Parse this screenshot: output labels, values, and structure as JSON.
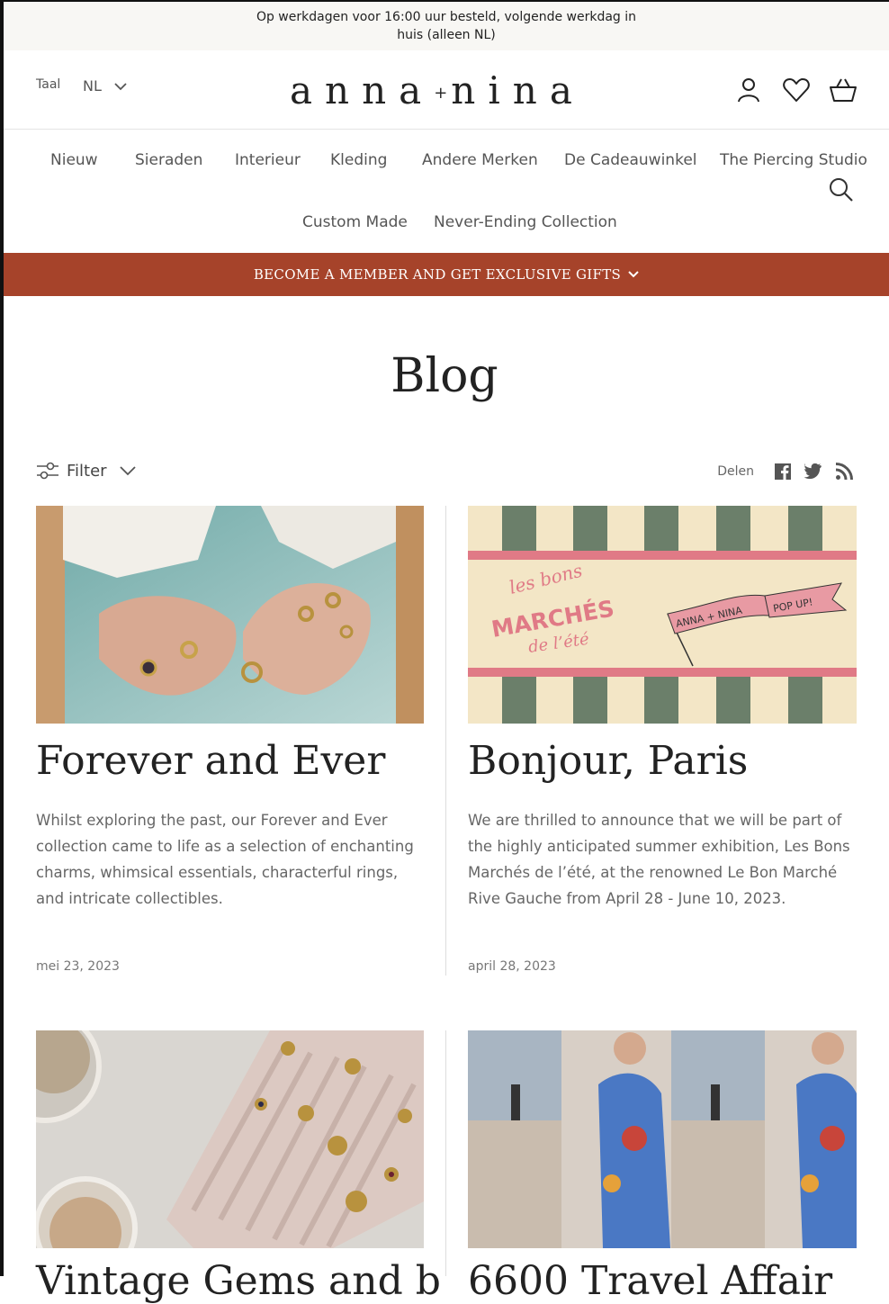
{
  "announcement": {
    "text": "Op werkdagen voor 16:00 uur besteld, volgende werkdag in huis (alleen NL)"
  },
  "header": {
    "language_label": "Taal",
    "language_value": "NL",
    "logo_left": "anna",
    "logo_plus": "+",
    "logo_right": "nina"
  },
  "nav": {
    "items": [
      "Nieuw",
      "Sieraden",
      "Interieur",
      "Kleding",
      "Andere Merken",
      "De Cadeauwinkel",
      "The Piercing Studio",
      "Custom Made",
      "Never-Ending Collection"
    ]
  },
  "promo": {
    "text": "BECOME A MEMBER AND GET EXCLUSIVE GIFTS"
  },
  "page": {
    "title": "Blog"
  },
  "toolbar": {
    "filter_label": "Filter",
    "share_label": "Delen"
  },
  "posts": [
    {
      "title": "Forever and Ever",
      "excerpt": "Whilst exploring the past, our Forever and Ever collection came to life as a selection of enchanting charms, whimsical essentials, characterful rings, and intricate collectibles.",
      "date": "mei 23, 2023"
    },
    {
      "title": "Bonjour, Paris",
      "excerpt": "We are thrilled to announce that we will be part of the highly anticipated summer exhibition, Les Bons Marchés de l’été, at the renowned Le Bon Marché Rive Gauche from April 28 - June 10, 2023.",
      "date": "april 28, 2023",
      "banner": {
        "line1": "les bons",
        "line2": "MARCHÉS",
        "line3": "de l’été",
        "flag": "ANNA + NINA",
        "flag2": "POP UP!"
      }
    },
    {
      "title": "Vintage Gems and b",
      "excerpt": "",
      "date": ""
    },
    {
      "title": "6600 Travel Affair",
      "excerpt": "",
      "date": ""
    }
  ],
  "colors": {
    "promo_bg": "#a6432a",
    "announce_bg": "#f8f7f4",
    "stripe_green": "#6b7f6a",
    "stripe_cream": "#f3e6c6",
    "banner_pink": "#e07a86"
  },
  "icons": [
    "account-icon",
    "wishlist-heart-icon",
    "basket-icon",
    "search-icon",
    "filter-icon",
    "facebook-icon",
    "twitter-icon",
    "rss-icon",
    "chevron-down-icon"
  ]
}
